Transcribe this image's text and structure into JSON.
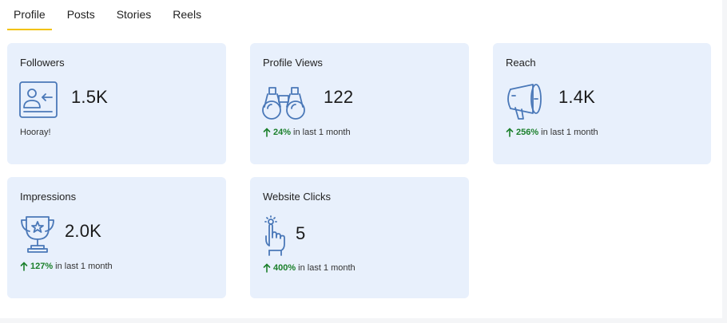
{
  "tabs": [
    {
      "label": "Profile",
      "active": true
    },
    {
      "label": "Posts",
      "active": false
    },
    {
      "label": "Stories",
      "active": false
    },
    {
      "label": "Reels",
      "active": false
    }
  ],
  "cards": {
    "followers": {
      "title": "Followers",
      "value": "1.5K",
      "note": "Hooray!",
      "icon": "follower-card-icon"
    },
    "profile_views": {
      "title": "Profile Views",
      "value": "122",
      "change": "24%",
      "suffix": "in last 1 month",
      "icon": "binoculars-icon"
    },
    "reach": {
      "title": "Reach",
      "value": "1.4K",
      "change": "256%",
      "suffix": "in last 1 month",
      "icon": "megaphone-icon"
    },
    "impressions": {
      "title": "Impressions",
      "value": "2.0K",
      "change": "127%",
      "suffix": "in last 1 month",
      "icon": "trophy-icon"
    },
    "website_clicks": {
      "title": "Website Clicks",
      "value": "5",
      "change": "400%",
      "suffix": "in last 1 month",
      "icon": "tap-hand-icon"
    }
  },
  "colors": {
    "accent_tab": "#f2c200",
    "card_bg": "#e8f0fc",
    "icon_stroke": "#4a78b8",
    "positive": "#1a7f2a"
  }
}
